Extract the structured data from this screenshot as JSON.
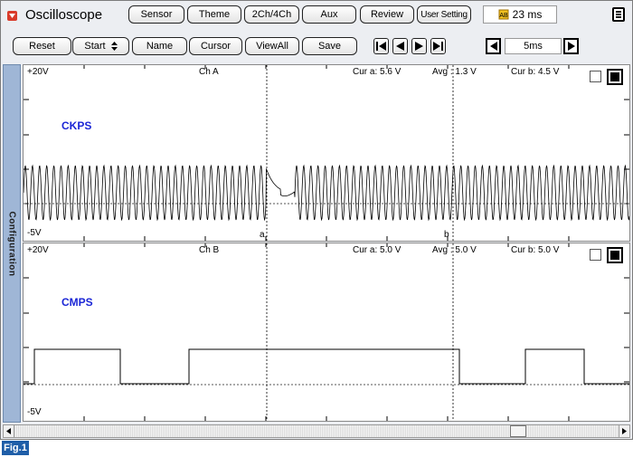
{
  "toolbar": {
    "app_title": "Oscilloscope",
    "sensor": "Sensor",
    "theme": "Theme",
    "ch_mode": "2Ch/4Ch",
    "aux": "Aux",
    "review": "Review",
    "user_setting": "User Setting",
    "capture_time": "23 ms"
  },
  "controls": {
    "reset": "Reset",
    "start": "Start",
    "name": "Name",
    "cursor": "Cursor",
    "view_all": "ViewAll",
    "save": "Save",
    "time_div": "5ms"
  },
  "side_tab": {
    "label": "Configuration"
  },
  "channels": [
    {
      "id": "ch-a",
      "top_label": "+20V",
      "bottom_label": "-5V",
      "name": "Ch A",
      "cur_a": "Cur a: 5.6 V",
      "avg": "Avg : 1.3 V",
      "cur_b": "Cur b: 4.5 V",
      "signal": "CKPS",
      "cursor_a_label": "a",
      "cursor_b_label": "b"
    },
    {
      "id": "ch-b",
      "top_label": "+20V",
      "bottom_label": "-5V",
      "name": "Ch B",
      "cur_a": "Cur a: 5.0 V",
      "avg": "Avg : 5.0 V",
      "cur_b": "Cur b: 5.0 V",
      "signal": "CMPS"
    }
  ],
  "scroll": {
    "position": 0.84
  },
  "figure": {
    "label": "Fig.1"
  },
  "colors": {
    "signal_label": "#1b26d6",
    "fig_label_bg": "#1f5ea8",
    "side_tab": "#9fb6d6",
    "close_icon": "#d93b2b"
  }
}
